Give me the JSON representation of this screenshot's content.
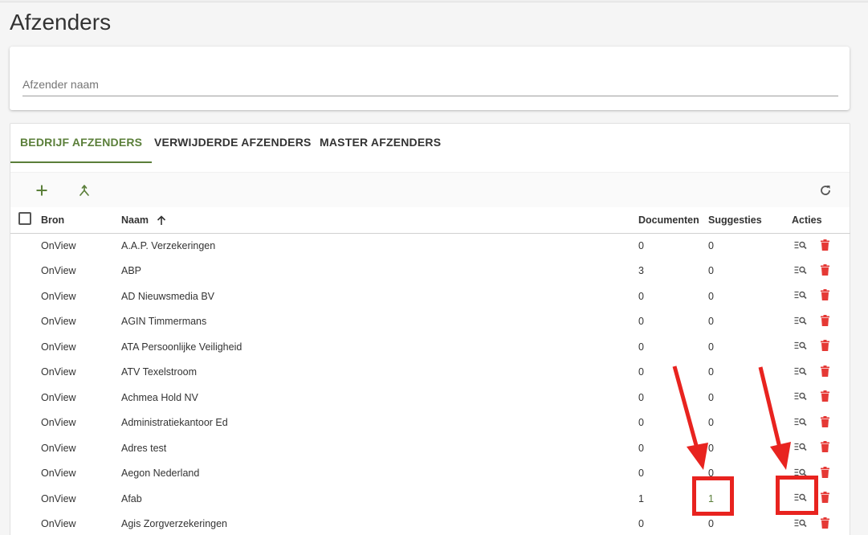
{
  "page": {
    "title": "Afzenders"
  },
  "search": {
    "placeholder": "Afzender naam"
  },
  "tabs": [
    {
      "label": "BEDRIJF AFZENDERS",
      "active": true
    },
    {
      "label": "VERWIJDERDE AFZENDERS",
      "active": false
    },
    {
      "label": "MASTER AFZENDERS",
      "active": false
    }
  ],
  "toolbar": {
    "add_icon": "plus-icon",
    "merge_icon": "merge-icon",
    "refresh_icon": "refresh-icon"
  },
  "table": {
    "headers": {
      "bron": "Bron",
      "naam": "Naam",
      "documenten": "Documenten",
      "suggesties": "Suggesties",
      "acties": "Acties"
    },
    "sort": {
      "column": "naam",
      "direction": "ascending"
    },
    "rows": [
      {
        "bron": "OnView",
        "naam": "A.A.P. Verzekeringen",
        "documenten": "0",
        "suggesties": "0"
      },
      {
        "bron": "OnView",
        "naam": "ABP",
        "documenten": "3",
        "suggesties": "0"
      },
      {
        "bron": "OnView",
        "naam": "AD Nieuwsmedia BV",
        "documenten": "0",
        "suggesties": "0"
      },
      {
        "bron": "OnView",
        "naam": "AGIN Timmermans",
        "documenten": "0",
        "suggesties": "0"
      },
      {
        "bron": "OnView",
        "naam": "ATA Persoonlijke Veiligheid",
        "documenten": "0",
        "suggesties": "0"
      },
      {
        "bron": "OnView",
        "naam": "ATV Texelstroom",
        "documenten": "0",
        "suggesties": "0"
      },
      {
        "bron": "OnView",
        "naam": "Achmea Hold NV",
        "documenten": "0",
        "suggesties": "0"
      },
      {
        "bron": "OnView",
        "naam": "Administratiekantoor Ed",
        "documenten": "0",
        "suggesties": "0"
      },
      {
        "bron": "OnView",
        "naam": "Adres test",
        "documenten": "0",
        "suggesties": "0"
      },
      {
        "bron": "OnView",
        "naam": "Aegon Nederland",
        "documenten": "0",
        "suggesties": "0"
      },
      {
        "bron": "OnView",
        "naam": "Afab",
        "documenten": "1",
        "suggesties": "1",
        "highlighted": true
      },
      {
        "bron": "OnView",
        "naam": "Agis Zorgverzekeringen",
        "documenten": "0",
        "suggesties": "0"
      }
    ]
  },
  "colors": {
    "accent": "#5b7f3a",
    "delete": "#e53935",
    "annotation": "#e8231f"
  }
}
